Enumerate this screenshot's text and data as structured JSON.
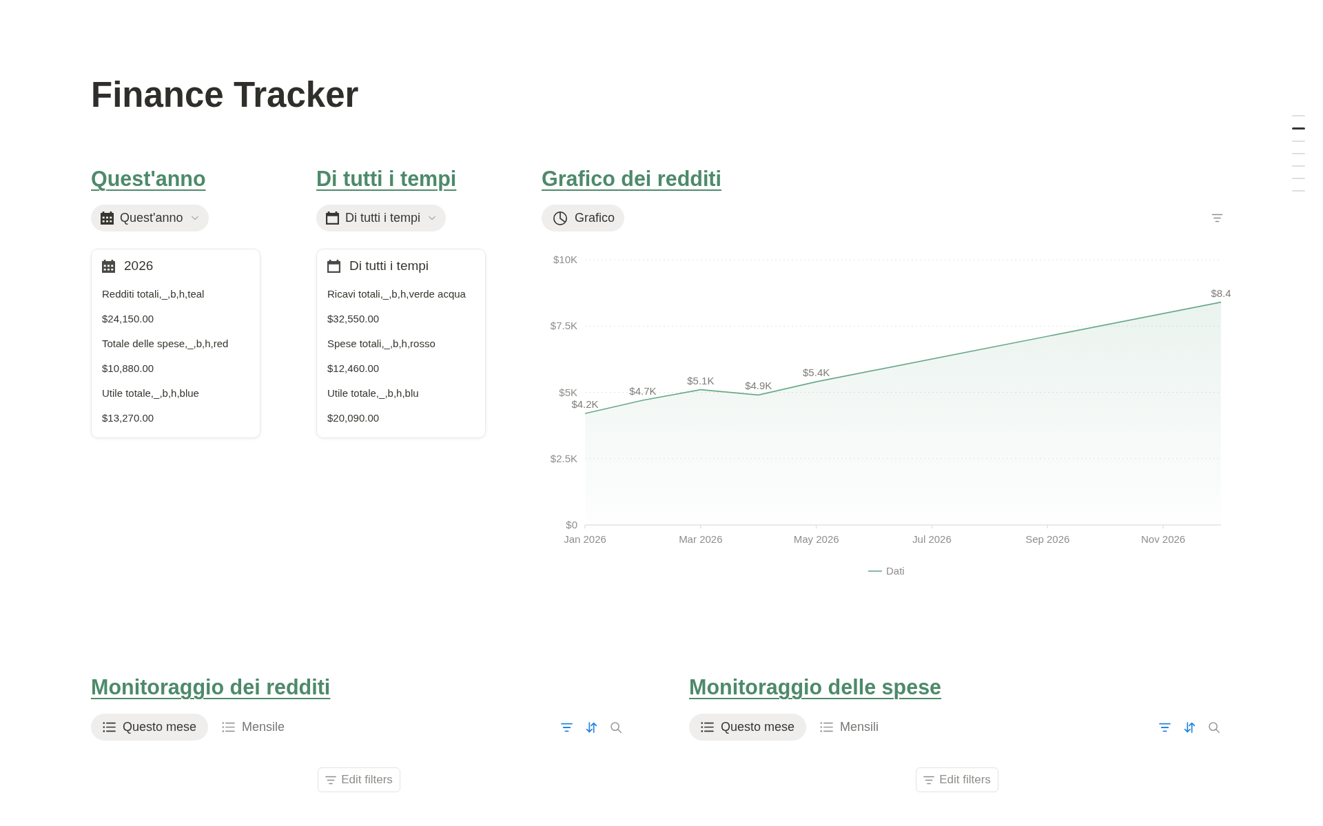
{
  "page": {
    "title": "Finance Tracker"
  },
  "outline": [
    {
      "selected": false
    },
    {
      "selected": true
    },
    {
      "selected": false
    },
    {
      "selected": false
    },
    {
      "selected": false
    },
    {
      "selected": false
    },
    {
      "selected": false
    }
  ],
  "sections": [
    {
      "kind": "cards",
      "heading": "Quest'anno",
      "view": {
        "label": "Quest'anno",
        "selected": true
      },
      "cards": [
        {
          "title": "2026",
          "fields": [
            {
              "label": "Redditi totali,_,b,h,teal",
              "value": "$24,150.00"
            },
            {
              "label": "Totale delle spese,_,b,h,red",
              "value": "$10,880.00"
            },
            {
              "label": "Utile totale,_,b,h,blue",
              "value": "$13,270.00"
            }
          ]
        }
      ]
    },
    {
      "kind": "cards",
      "heading": "Di tutti i tempi",
      "view": {
        "label": "Di tutti i tempi",
        "selected": true
      },
      "cards": [
        {
          "title": "Di tutti i tempi",
          "fields": [
            {
              "label": "Ricavi totali,_,b,h,verde acqua",
              "value": "$32,550.00"
            },
            {
              "label": "Spese totali,_,b,h,rosso",
              "value": "$12,460.00"
            },
            {
              "label": "Utile totale,_,b,h,blu",
              "value": "$20,090.00"
            }
          ]
        }
      ]
    },
    {
      "kind": "chart",
      "heading": "Grafico dei redditi",
      "view": {
        "label": "Grafico",
        "selected": true
      },
      "filters_on": false,
      "chart_data": {
        "type": "area",
        "grid": true,
        "categories": [
          "Jan 2026",
          null,
          "Mar 2026",
          null,
          "May 2026",
          null,
          "Jul 2026",
          null,
          "Sep 2026",
          null,
          "Nov 2026",
          null
        ],
        "ylim": [
          0,
          10000
        ],
        "yticks": [
          {
            "value": 0,
            "label": "$0"
          },
          {
            "value": 2500,
            "label": "$2.5K"
          },
          {
            "value": 5000,
            "label": "$5K"
          },
          {
            "value": 7500,
            "label": "$7.5K"
          },
          {
            "value": 10000,
            "label": "$10K"
          }
        ],
        "series": [
          {
            "name": "Dati",
            "color": "#6aa98a",
            "values": [
              4200,
              4700,
              5100,
              4900,
              5400,
              null,
              null,
              null,
              null,
              null,
              null,
              8400
            ]
          }
        ],
        "value_labels": [
          "$4.2K",
          "$4.7K",
          "$5.1K",
          "$4.9K",
          "$5.4K",
          null,
          null,
          null,
          null,
          null,
          null,
          "$8.4"
        ]
      }
    }
  ],
  "trackers": [
    {
      "heading": "Monitoraggio dei redditi",
      "tabs": [
        {
          "label": "Questo mese",
          "selected": true
        },
        {
          "label": "Mensile",
          "selected": false
        }
      ],
      "filters_on": true,
      "sorts_on": true,
      "action": "Edit filters"
    },
    {
      "heading": "Monitoraggio delle spese",
      "tabs": [
        {
          "label": "Questo mese",
          "selected": true
        },
        {
          "label": "Mensili",
          "selected": false
        }
      ],
      "filters_on": true,
      "sorts_on": true,
      "action": "Edit filters"
    }
  ]
}
